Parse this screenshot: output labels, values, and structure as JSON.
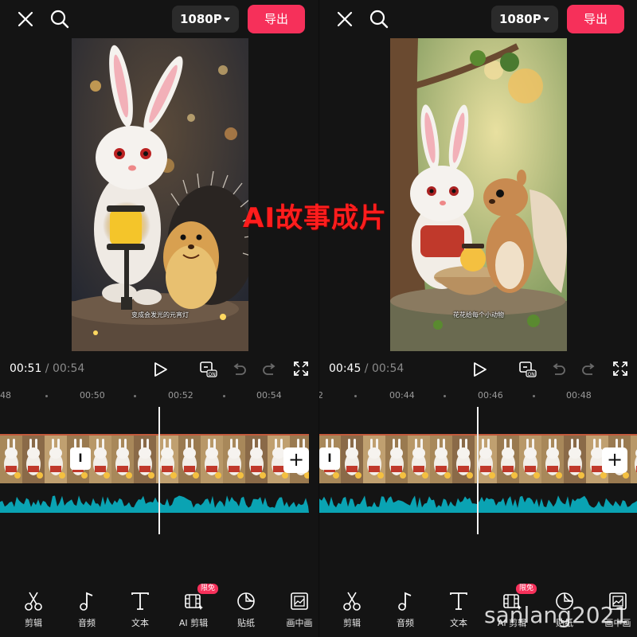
{
  "headline": "AI故事成片",
  "watermark": "sanlang2021",
  "colors": {
    "accent": "#f6305a",
    "waveform": "#0aa3b3",
    "background": "#141414"
  },
  "left": {
    "toolbar": {
      "close_icon": "close-icon",
      "search_icon": "search-icon",
      "resolution": "1080P",
      "export_label": "导出"
    },
    "preview": {
      "subtitle": "变成会发光的元宵灯"
    },
    "player": {
      "current_time": "00:51",
      "separator": " / ",
      "total_time": "00:54"
    },
    "ruler": [
      "48",
      "00:50",
      "00:52",
      "00:54"
    ],
    "tools": [
      {
        "label": "剪辑",
        "icon": "scissors-icon"
      },
      {
        "label": "音频",
        "icon": "music-note-icon"
      },
      {
        "label": "文本",
        "icon": "text-icon"
      },
      {
        "label": "AI 剪辑",
        "icon": "ai-film-icon",
        "badge": "限免"
      },
      {
        "label": "贴纸",
        "icon": "sticker-icon"
      },
      {
        "label": "画中画",
        "icon": "picture-in-picture-icon"
      }
    ]
  },
  "right": {
    "toolbar": {
      "close_icon": "close-icon",
      "search_icon": "search-icon",
      "resolution": "1080P",
      "export_label": "导出"
    },
    "preview": {
      "subtitle": "花花给每个小动物"
    },
    "player": {
      "current_time": "00:45",
      "separator": " / ",
      "total_time": "00:54"
    },
    "ruler": [
      "2",
      "00:44",
      "00:46",
      "00:48"
    ],
    "tools": [
      {
        "label": "剪辑",
        "icon": "scissors-icon"
      },
      {
        "label": "音频",
        "icon": "music-note-icon"
      },
      {
        "label": "文本",
        "icon": "text-icon"
      },
      {
        "label": "AI 剪辑",
        "icon": "ai-film-icon",
        "badge": "限免"
      },
      {
        "label": "贴纸",
        "icon": "sticker-icon"
      },
      {
        "label": "画中画",
        "icon": "picture-in-picture-icon"
      }
    ]
  }
}
